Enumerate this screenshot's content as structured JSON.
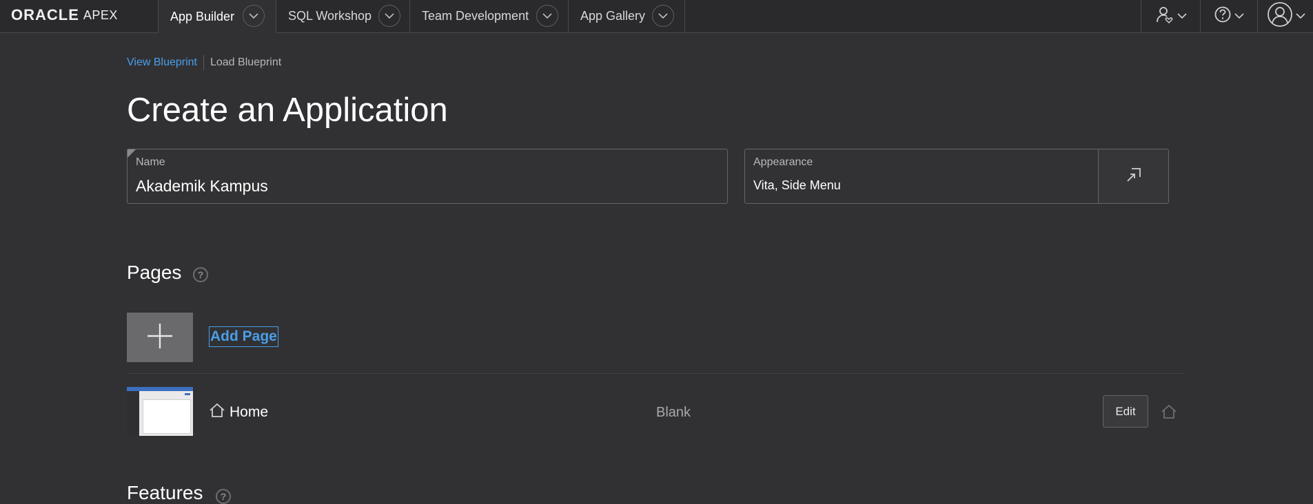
{
  "header": {
    "logo_brand": "ORACLE",
    "logo_product": "APEX",
    "tabs": [
      {
        "label": "App Builder",
        "active": true
      },
      {
        "label": "SQL Workshop",
        "active": false
      },
      {
        "label": "Team Development",
        "active": false
      },
      {
        "label": "App Gallery",
        "active": false
      }
    ],
    "right_icons": [
      "user-heart-icon",
      "help-icon",
      "user-profile-icon"
    ]
  },
  "breadcrumb": {
    "view_blueprint": "View Blueprint",
    "load_blueprint": "Load Blueprint"
  },
  "page_title": "Create an Application",
  "name_field": {
    "label": "Name",
    "value": "Akademik Kampus"
  },
  "appearance_field": {
    "label": "Appearance",
    "value": "Vita, Side Menu",
    "button_icon": "open-dialog-icon"
  },
  "pages_section": {
    "title": "Pages",
    "add_page_label": "Add Page",
    "items": [
      {
        "name": "Home",
        "type": "Blank",
        "edit_label": "Edit",
        "is_home": true
      }
    ]
  },
  "features_section": {
    "title": "Features"
  },
  "colors": {
    "background": "#313134",
    "topbar": "#2a2a2d",
    "link": "#4a9ee8",
    "tile": "#6a6a6c"
  }
}
